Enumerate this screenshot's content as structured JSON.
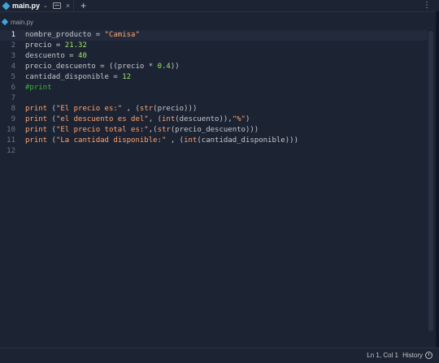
{
  "tab": {
    "filename": "main.py",
    "chevron": "⌄",
    "close": "×",
    "add": "+",
    "menu": "⋮"
  },
  "breadcrumb": {
    "filename": "main.py"
  },
  "editor": {
    "lines": [
      {
        "n": "1",
        "tokens": [
          [
            "nombre_producto = ",
            "op"
          ],
          [
            "\"Camisa\"",
            "str"
          ]
        ]
      },
      {
        "n": "2",
        "tokens": [
          [
            "precio = ",
            "op"
          ],
          [
            "21.32",
            "num"
          ]
        ]
      },
      {
        "n": "3",
        "tokens": [
          [
            "descuento = ",
            "op"
          ],
          [
            "40",
            "num"
          ]
        ]
      },
      {
        "n": "4",
        "tokens": [
          [
            "precio_descuento = ((precio * ",
            "op"
          ],
          [
            "0.4",
            "num"
          ],
          [
            "))",
            "op"
          ]
        ]
      },
      {
        "n": "5",
        "tokens": [
          [
            "cantidad_disponible = ",
            "op"
          ],
          [
            "12",
            "num"
          ]
        ]
      },
      {
        "n": "6",
        "tokens": [
          [
            "#print",
            "com"
          ]
        ]
      },
      {
        "n": "7",
        "tokens": []
      },
      {
        "n": "8",
        "tokens": [
          [
            "print",
            "fn"
          ],
          [
            " (",
            "op"
          ],
          [
            "\"El precio es:\"",
            "str"
          ],
          [
            " , (",
            "op"
          ],
          [
            "str",
            "kw"
          ],
          [
            "(precio)))",
            "op"
          ]
        ]
      },
      {
        "n": "9",
        "tokens": [
          [
            "print",
            "fn"
          ],
          [
            " (",
            "op"
          ],
          [
            "\"el descuento es del\"",
            "str"
          ],
          [
            ", (",
            "op"
          ],
          [
            "int",
            "kw"
          ],
          [
            "(descuento)),",
            "op"
          ],
          [
            "\"%\"",
            "str"
          ],
          [
            ")",
            "op"
          ]
        ]
      },
      {
        "n": "10",
        "tokens": [
          [
            "print",
            "fn"
          ],
          [
            " (",
            "op"
          ],
          [
            "\"El precio total es:\"",
            "str"
          ],
          [
            ",(",
            "op"
          ],
          [
            "str",
            "kw"
          ],
          [
            "(precio_descuento)))",
            "op"
          ]
        ]
      },
      {
        "n": "11",
        "tokens": [
          [
            "print",
            "fn"
          ],
          [
            " (",
            "op"
          ],
          [
            "\"La cantidad disponible:\"",
            "str"
          ],
          [
            " , (",
            "op"
          ],
          [
            "int",
            "kw"
          ],
          [
            "(cantidad_disponible)))",
            "op"
          ]
        ]
      },
      {
        "n": "12",
        "tokens": []
      }
    ],
    "active_line": "1"
  },
  "status": {
    "cursor": "Ln 1, Col 1",
    "history": "History"
  }
}
